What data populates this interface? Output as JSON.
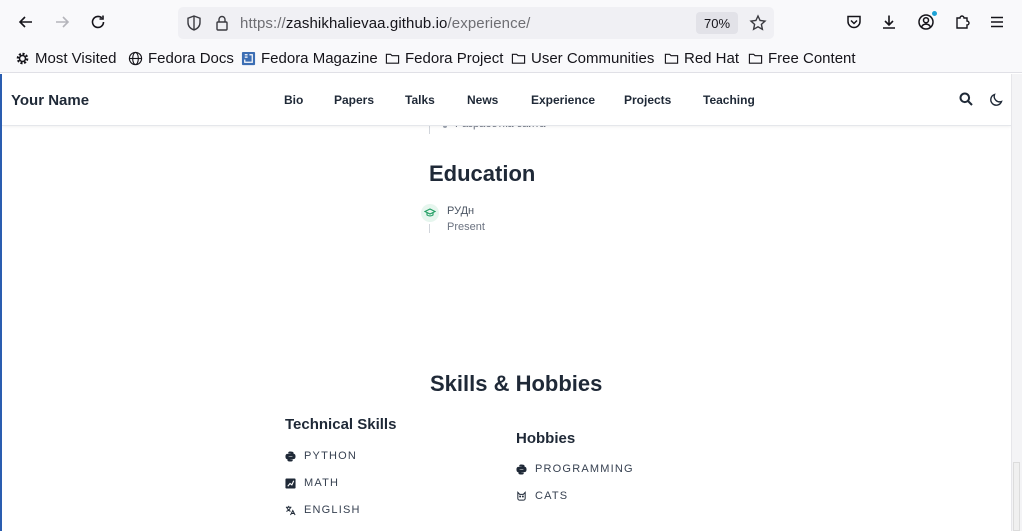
{
  "browser": {
    "url": {
      "scheme": "https://",
      "host": "zashikhalievaa.github.io",
      "path": "/experience/"
    },
    "zoom": "70%",
    "bookmarks": [
      {
        "label": "Most Visited",
        "icon": "gear-icon"
      },
      {
        "label": "Fedora Docs",
        "icon": "globe-icon"
      },
      {
        "label": "Fedora Magazine",
        "icon": "fedora-magazine-icon"
      },
      {
        "label": "Fedora Project",
        "icon": "folder-icon"
      },
      {
        "label": "User Communities",
        "icon": "folder-icon"
      },
      {
        "label": "Red Hat",
        "icon": "folder-icon"
      },
      {
        "label": "Free Content",
        "icon": "folder-icon"
      }
    ]
  },
  "site": {
    "brand": "Your Name",
    "nav": [
      "Bio",
      "Papers",
      "Talks",
      "News",
      "Experience",
      "Projects",
      "Teaching"
    ]
  },
  "experience": {
    "partial_item": "Разработка сайта"
  },
  "education": {
    "title": "Education",
    "items": [
      {
        "school": "РУДн",
        "date": "Present",
        "icon": "graduation-cap-icon"
      }
    ]
  },
  "skills": {
    "title": "Skills & Hobbies",
    "technical": {
      "title": "Technical Skills",
      "items": [
        {
          "label": "PYTHON",
          "icon": "python-icon"
        },
        {
          "label": "MATH",
          "icon": "chart-icon"
        },
        {
          "label": "ENGLISH",
          "icon": "language-icon"
        }
      ]
    },
    "hobbies": {
      "title": "Hobbies",
      "items": [
        {
          "label": "PROGRAMMING",
          "icon": "python-icon"
        },
        {
          "label": "CATS",
          "icon": "cat-icon"
        }
      ]
    }
  },
  "colors": {
    "accent": "#1f9d62",
    "text": "#1f2937",
    "toolbar_bg": "#f9f9fb"
  }
}
